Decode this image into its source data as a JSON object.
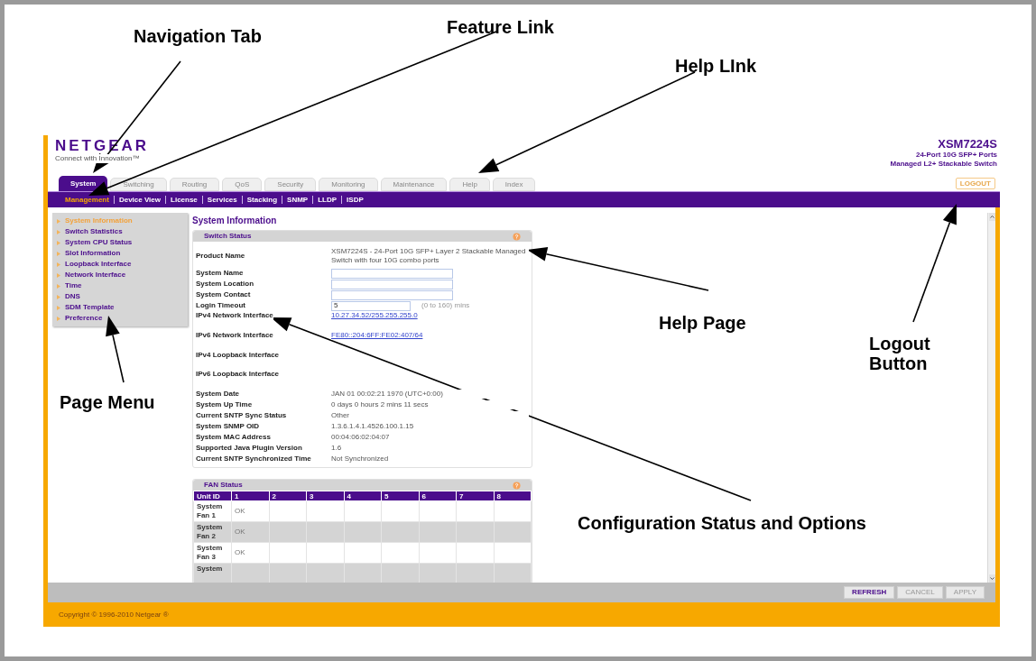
{
  "header": {
    "logo": "NETGEAR",
    "tagline": "Connect with Innovation™",
    "model": "XSM7224S",
    "description": [
      "24-Port 10G SFP+ Ports",
      "Managed L2+ Stackable Switch"
    ]
  },
  "tabs": [
    {
      "label": "System",
      "selected": true
    },
    {
      "label": "Switching",
      "selected": false
    },
    {
      "label": "Routing",
      "selected": false
    },
    {
      "label": "QoS",
      "selected": false
    },
    {
      "label": "Security",
      "selected": false
    },
    {
      "label": "Monitoring",
      "selected": false
    },
    {
      "label": "Maintenance",
      "selected": false
    },
    {
      "label": "Help",
      "selected": false
    },
    {
      "label": "Index",
      "selected": false
    }
  ],
  "logout": "LOGOUT",
  "feature_links": [
    {
      "label": "Management",
      "selected": true
    },
    {
      "label": "Device View",
      "selected": false
    },
    {
      "label": "License",
      "selected": false
    },
    {
      "label": "Services",
      "selected": false
    },
    {
      "label": "Stacking",
      "selected": false
    },
    {
      "label": "SNMP",
      "selected": false
    },
    {
      "label": "LLDP",
      "selected": false
    },
    {
      "label": "ISDP",
      "selected": false
    }
  ],
  "page_menu": [
    {
      "label": "System Information",
      "selected": true
    },
    {
      "label": "Switch Statistics",
      "selected": false
    },
    {
      "label": "System CPU Status",
      "selected": false
    },
    {
      "label": "Slot Information",
      "selected": false
    },
    {
      "label": "Loopback Interface",
      "selected": false
    },
    {
      "label": "Network Interface",
      "selected": false
    },
    {
      "label": "Time",
      "selected": false
    },
    {
      "label": "DNS",
      "selected": false
    },
    {
      "label": "SDM Template",
      "selected": false
    },
    {
      "label": "Preference",
      "selected": false
    }
  ],
  "page_title": "System Information",
  "switch_status": {
    "title": "Switch Status",
    "rows": [
      {
        "kind": "text",
        "label": "Product Name",
        "value": "XSM7224S - 24-Port 10G SFP+ Layer 2 Stackable Managed Switch with four 10G combo ports"
      },
      {
        "kind": "input",
        "label": "System Name"
      },
      {
        "kind": "input",
        "label": "System Location"
      },
      {
        "kind": "input",
        "label": "System Contact"
      },
      {
        "kind": "input",
        "label": "Login Timeout",
        "value": "5",
        "note": "(0 to 160) mins"
      },
      {
        "kind": "link",
        "label": "IPv4 Network Interface",
        "value": "10.27.34.52/255.255.255.0"
      },
      {
        "kind": "link",
        "label": "IPv6 Network Interface",
        "value": "FE80::204:6FF:FE02:407/64"
      },
      {
        "kind": "blank",
        "label": "IPv4 Loopback Interface"
      },
      {
        "kind": "blank",
        "label": "IPv6 Loopback Interface"
      },
      {
        "kind": "text",
        "label": "System Date",
        "value": "JAN 01 00:02:21 1970 (UTC+0:00)"
      },
      {
        "kind": "text",
        "label": "System Up Time",
        "value": "0 days 0 hours 2 mins 11 secs"
      },
      {
        "kind": "text",
        "label": "Current SNTP Sync Status",
        "value": "Other"
      },
      {
        "kind": "text",
        "label": "System SNMP OID",
        "value": "1.3.6.1.4.1.4526.100.1.15"
      },
      {
        "kind": "text",
        "label": "System MAC Address",
        "value": "00:04:06:02:04:07"
      },
      {
        "kind": "text",
        "label": "Supported Java Plugin Version",
        "value": "1.6"
      },
      {
        "kind": "text",
        "label": "Current SNTP Synchronized Time",
        "value": "Not Synchronized"
      }
    ]
  },
  "fan_status": {
    "title": "FAN Status",
    "columns": [
      "Unit ID",
      "1",
      "2",
      "3",
      "4",
      "5",
      "6",
      "7",
      "8"
    ],
    "rows": [
      {
        "cells": [
          "System Fan 1",
          "OK"
        ]
      },
      {
        "cells": [
          "System Fan 2",
          "OK"
        ]
      },
      {
        "cells": [
          "System Fan 3",
          "OK"
        ]
      },
      {
        "cells": [
          "System"
        ]
      }
    ]
  },
  "buttons": [
    {
      "label": "REFRESH",
      "disabled": false
    },
    {
      "label": "CANCEL",
      "disabled": true
    },
    {
      "label": "APPLY",
      "disabled": true
    }
  ],
  "copyright": "Copyright © 1996-2010 Netgear ®",
  "annotations": [
    {
      "text": "Navigation Tab"
    },
    {
      "text": "Feature Link"
    },
    {
      "text": "Help LInk"
    },
    {
      "text": "Help Page"
    },
    {
      "text": "Logout Button"
    },
    {
      "text": "Page Menu"
    },
    {
      "text": "Configuration Status and Options"
    }
  ]
}
